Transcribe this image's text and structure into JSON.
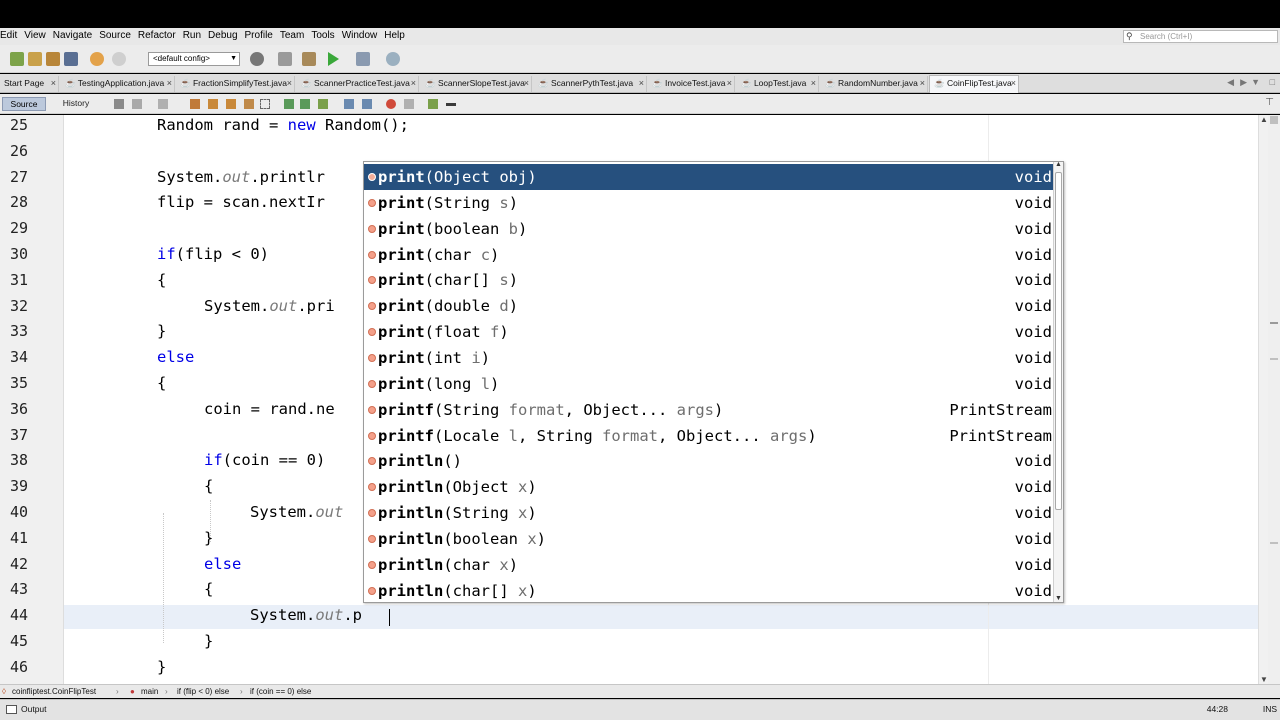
{
  "menu": [
    "Edit",
    "View",
    "Navigate",
    "Source",
    "Refactor",
    "Run",
    "Debug",
    "Profile",
    "Team",
    "Tools",
    "Window",
    "Help"
  ],
  "search": {
    "placeholder": "Search (Ctrl+I)"
  },
  "toolbar": {
    "config": "<default config>"
  },
  "tabs": [
    {
      "label": "Start Page",
      "active": false
    },
    {
      "label": "TestingApplication.java",
      "active": false
    },
    {
      "label": "FractionSimplifyTest.java",
      "active": false
    },
    {
      "label": "ScannerPracticeTest.java",
      "active": false
    },
    {
      "label": "ScannerSlopeTest.java",
      "active": false
    },
    {
      "label": "ScannerPythTest.java",
      "active": false
    },
    {
      "label": "InvoiceTest.java",
      "active": false
    },
    {
      "label": "LoopTest.java",
      "active": false
    },
    {
      "label": "RandomNumber.java",
      "active": false
    },
    {
      "label": "CoinFlipTest.java",
      "active": true
    }
  ],
  "editor_modes": {
    "source": "Source",
    "history": "History"
  },
  "lines": [
    {
      "n": "25",
      "indent": 2,
      "segs": [
        {
          "t": "Random rand = "
        },
        {
          "t": "new",
          "c": "kw"
        },
        {
          "t": " Random();"
        }
      ]
    },
    {
      "n": "26",
      "indent": 0,
      "segs": []
    },
    {
      "n": "27",
      "indent": 2,
      "segs": [
        {
          "t": "System."
        },
        {
          "t": "out",
          "c": "it"
        },
        {
          "t": ".printlr"
        }
      ]
    },
    {
      "n": "28",
      "indent": 2,
      "segs": [
        {
          "t": "flip = scan.nextIr"
        }
      ]
    },
    {
      "n": "29",
      "indent": 0,
      "segs": []
    },
    {
      "n": "30",
      "indent": 2,
      "segs": [
        {
          "t": "if",
          "c": "kw"
        },
        {
          "t": "(flip < 0)"
        }
      ]
    },
    {
      "n": "31",
      "indent": 2,
      "segs": [
        {
          "t": "{"
        }
      ]
    },
    {
      "n": "32",
      "indent": 3,
      "segs": [
        {
          "t": "System."
        },
        {
          "t": "out",
          "c": "it"
        },
        {
          "t": ".pri"
        }
      ]
    },
    {
      "n": "33",
      "indent": 2,
      "segs": [
        {
          "t": "}"
        }
      ]
    },
    {
      "n": "34",
      "indent": 2,
      "segs": [
        {
          "t": "else",
          "c": "kw"
        }
      ]
    },
    {
      "n": "35",
      "indent": 2,
      "segs": [
        {
          "t": "{"
        }
      ]
    },
    {
      "n": "36",
      "indent": 3,
      "segs": [
        {
          "t": "coin = rand.ne"
        }
      ]
    },
    {
      "n": "37",
      "indent": 0,
      "segs": []
    },
    {
      "n": "38",
      "indent": 3,
      "segs": [
        {
          "t": "if",
          "c": "kw"
        },
        {
          "t": "(coin == 0)"
        }
      ]
    },
    {
      "n": "39",
      "indent": 3,
      "segs": [
        {
          "t": "{"
        }
      ]
    },
    {
      "n": "40",
      "indent": 4,
      "segs": [
        {
          "t": "System."
        },
        {
          "t": "out",
          "c": "it"
        }
      ]
    },
    {
      "n": "41",
      "indent": 3,
      "segs": [
        {
          "t": "}"
        }
      ]
    },
    {
      "n": "42",
      "indent": 3,
      "segs": [
        {
          "t": "else",
          "c": "kw"
        }
      ]
    },
    {
      "n": "43",
      "indent": 3,
      "segs": [
        {
          "t": "{"
        }
      ]
    },
    {
      "n": "44",
      "indent": 4,
      "segs": [
        {
          "t": "System."
        },
        {
          "t": "out",
          "c": "it"
        },
        {
          "t": ".p"
        }
      ]
    },
    {
      "n": "45",
      "indent": 3,
      "segs": [
        {
          "t": "}"
        }
      ]
    },
    {
      "n": "46",
      "indent": 2,
      "segs": [
        {
          "t": "}"
        }
      ]
    }
  ],
  "completion": [
    {
      "name": "print",
      "args": [
        {
          "t": "Object "
        },
        {
          "t": "obj",
          "p": true
        }
      ],
      "type": "void",
      "selected": true
    },
    {
      "name": "print",
      "args": [
        {
          "t": "String "
        },
        {
          "t": "s",
          "p": true
        }
      ],
      "type": "void"
    },
    {
      "name": "print",
      "args": [
        {
          "t": "boolean "
        },
        {
          "t": "b",
          "p": true
        }
      ],
      "type": "void"
    },
    {
      "name": "print",
      "args": [
        {
          "t": "char "
        },
        {
          "t": "c",
          "p": true
        }
      ],
      "type": "void"
    },
    {
      "name": "print",
      "args": [
        {
          "t": "char[] "
        },
        {
          "t": "s",
          "p": true
        }
      ],
      "type": "void"
    },
    {
      "name": "print",
      "args": [
        {
          "t": "double "
        },
        {
          "t": "d",
          "p": true
        }
      ],
      "type": "void"
    },
    {
      "name": "print",
      "args": [
        {
          "t": "float "
        },
        {
          "t": "f",
          "p": true
        }
      ],
      "type": "void"
    },
    {
      "name": "print",
      "args": [
        {
          "t": "int "
        },
        {
          "t": "i",
          "p": true
        }
      ],
      "type": "void"
    },
    {
      "name": "print",
      "args": [
        {
          "t": "long "
        },
        {
          "t": "l",
          "p": true
        }
      ],
      "type": "void"
    },
    {
      "name": "printf",
      "args": [
        {
          "t": "String "
        },
        {
          "t": "format",
          "p": true
        },
        {
          "t": ", Object... "
        },
        {
          "t": "args",
          "p": true
        }
      ],
      "type": "PrintStream"
    },
    {
      "name": "printf",
      "args": [
        {
          "t": "Locale "
        },
        {
          "t": "l",
          "p": true
        },
        {
          "t": ", String "
        },
        {
          "t": "format",
          "p": true
        },
        {
          "t": ", Object... "
        },
        {
          "t": "args",
          "p": true
        }
      ],
      "type": "PrintStream"
    },
    {
      "name": "println",
      "args": [],
      "type": "void"
    },
    {
      "name": "println",
      "args": [
        {
          "t": "Object "
        },
        {
          "t": "x",
          "p": true
        }
      ],
      "type": "void"
    },
    {
      "name": "println",
      "args": [
        {
          "t": "String "
        },
        {
          "t": "x",
          "p": true
        }
      ],
      "type": "void"
    },
    {
      "name": "println",
      "args": [
        {
          "t": "boolean "
        },
        {
          "t": "x",
          "p": true
        }
      ],
      "type": "void"
    },
    {
      "name": "println",
      "args": [
        {
          "t": "char "
        },
        {
          "t": "x",
          "p": true
        }
      ],
      "type": "void"
    },
    {
      "name": "println",
      "args": [
        {
          "t": "char[] "
        },
        {
          "t": "x",
          "p": true
        }
      ],
      "type": "void"
    }
  ],
  "breadcrumb": [
    "coinfliptest.CoinFlipTest",
    "main",
    "if (flip < 0) else",
    "if (coin == 0) else"
  ],
  "status": {
    "output": "Output",
    "position": "44:28",
    "mode": "INS"
  }
}
